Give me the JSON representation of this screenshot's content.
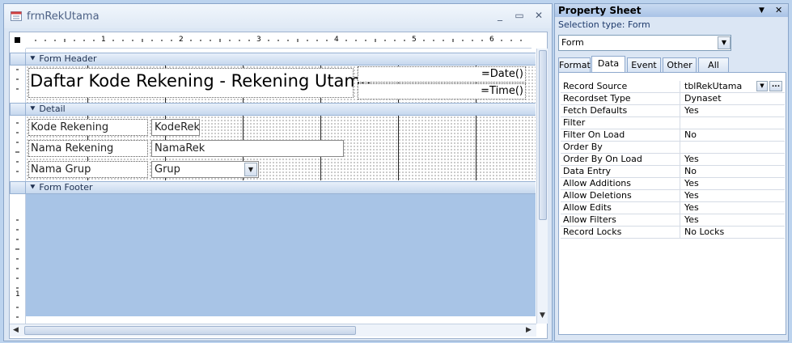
{
  "form_window": {
    "title": "frmRekUtama",
    "ruler_numbers": [
      "1",
      "2",
      "3",
      "4",
      "5",
      "6"
    ],
    "sections": {
      "header": "Form Header",
      "detail": "Detail",
      "footer": "Form Footer"
    },
    "header_title": "Daftar Kode Rekening - Rekening Utama",
    "date_field": "=Date()",
    "time_field": "=Time()",
    "fields": [
      {
        "label": "Kode Rekening",
        "value": "KodeRek"
      },
      {
        "label": "Nama Rekening",
        "value": "NamaRek"
      },
      {
        "label": "Nama Grup",
        "value": "Grup"
      }
    ]
  },
  "property_sheet": {
    "title": "Property Sheet",
    "selection_type": "Selection type:  Form",
    "selected_object": "Form",
    "tabs": [
      "Format",
      "Data",
      "Event",
      "Other",
      "All"
    ],
    "active_tab": "Data",
    "rows": [
      {
        "name": "Record Source",
        "value": "tblRekUtama"
      },
      {
        "name": "Recordset Type",
        "value": "Dynaset"
      },
      {
        "name": "Fetch Defaults",
        "value": "Yes"
      },
      {
        "name": "Filter",
        "value": ""
      },
      {
        "name": "Filter On Load",
        "value": "No"
      },
      {
        "name": "Order By",
        "value": ""
      },
      {
        "name": "Order By On Load",
        "value": "Yes"
      },
      {
        "name": "Data Entry",
        "value": "No"
      },
      {
        "name": "Allow Additions",
        "value": "Yes"
      },
      {
        "name": "Allow Deletions",
        "value": "Yes"
      },
      {
        "name": "Allow Edits",
        "value": "Yes"
      },
      {
        "name": "Allow Filters",
        "value": "Yes"
      },
      {
        "name": "Record Locks",
        "value": "No Locks"
      }
    ]
  }
}
